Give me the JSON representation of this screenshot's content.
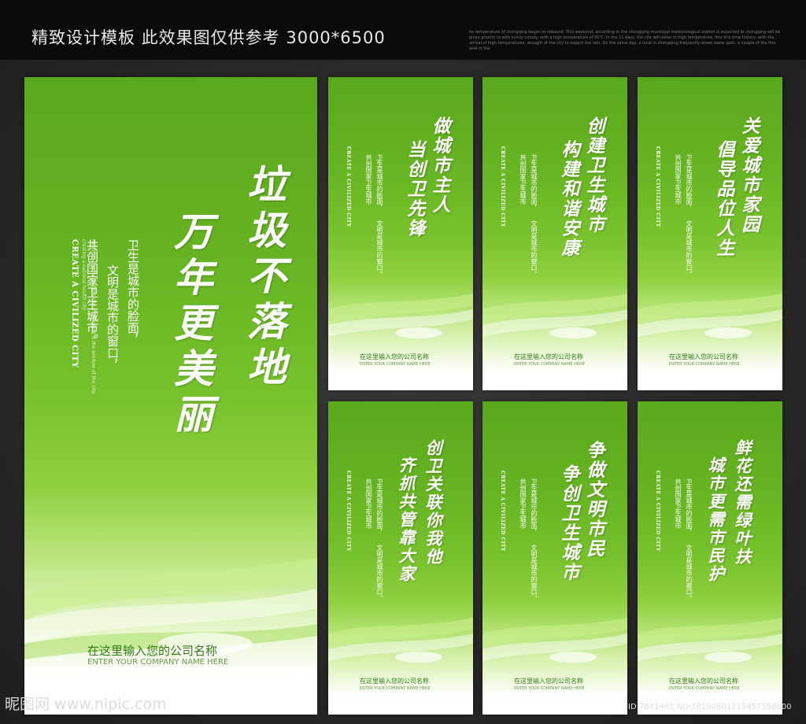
{
  "header": {
    "title": "精致设计模板 此效果图仅供参考 3000*6500",
    "note": "he temperature of chongqing began to rebound. This weekend, according to the chongqing municipal meteorological station is expected to chongqing will be given priority to with sunny cloudy, with a high temperature of 35℃. In the 11 days, the city will usher in high temperature, fine this time history, with the arrival of high temperatures, drought of the city to expect the rain. On the same day, a local in chongqing frequently street water park, a couple of the fine wire in the"
  },
  "big_panel": {
    "slogan_col1": "垃圾不落地",
    "slogan_col2": "万年更美丽",
    "body_col1": "卫生是城市的脸面，",
    "body_col2": "文明是城市的窗口，",
    "body_col3": "共创国家卫生城市。",
    "en_title": "CREATE A CIVILIZED CITY",
    "en_body1": "Health is the face of the city, civilization is the window of the city,",
    "en_body2": "creating a national health city",
    "company_cn": "在这里输入您的公司名称",
    "company_en": "ENTER YOUR COMPANY NAME HERE"
  },
  "small_panels": [
    {
      "slogan": [
        "做城市主人",
        "当创卫先锋"
      ]
    },
    {
      "slogan": [
        "创建卫生城市",
        "构建和谐安康"
      ]
    },
    {
      "slogan": [
        "关爱城市家园",
        "倡导品位人生"
      ]
    },
    {
      "slogan": [
        "创卫关联你我他",
        "齐抓共管靠大家"
      ]
    },
    {
      "slogan": [
        "争做文明市民",
        "争创卫生城市"
      ]
    },
    {
      "slogan": [
        "鲜花还需绿叶扶",
        "城市更需市民护"
      ]
    }
  ],
  "small_common": {
    "en_title": "CREATE A CIVILIZED CITY",
    "body_col1": "卫生是城市的脸面，",
    "body_col2": "共创国家卫生城市",
    "body_col3": "文明是城市的窗口。",
    "company_cn": "在这里输入您的公司名称",
    "company_en": "ENTER YOUR COMPANY NAME HERE"
  },
  "watermark": {
    "left": "昵图网 www.nipic.com",
    "right": "ID:7841461 NO:20190601215457558000"
  },
  "colors": {
    "green_dark": "#5aa81c",
    "green_light": "#8fd03e",
    "text_company": "#2e7a15"
  }
}
